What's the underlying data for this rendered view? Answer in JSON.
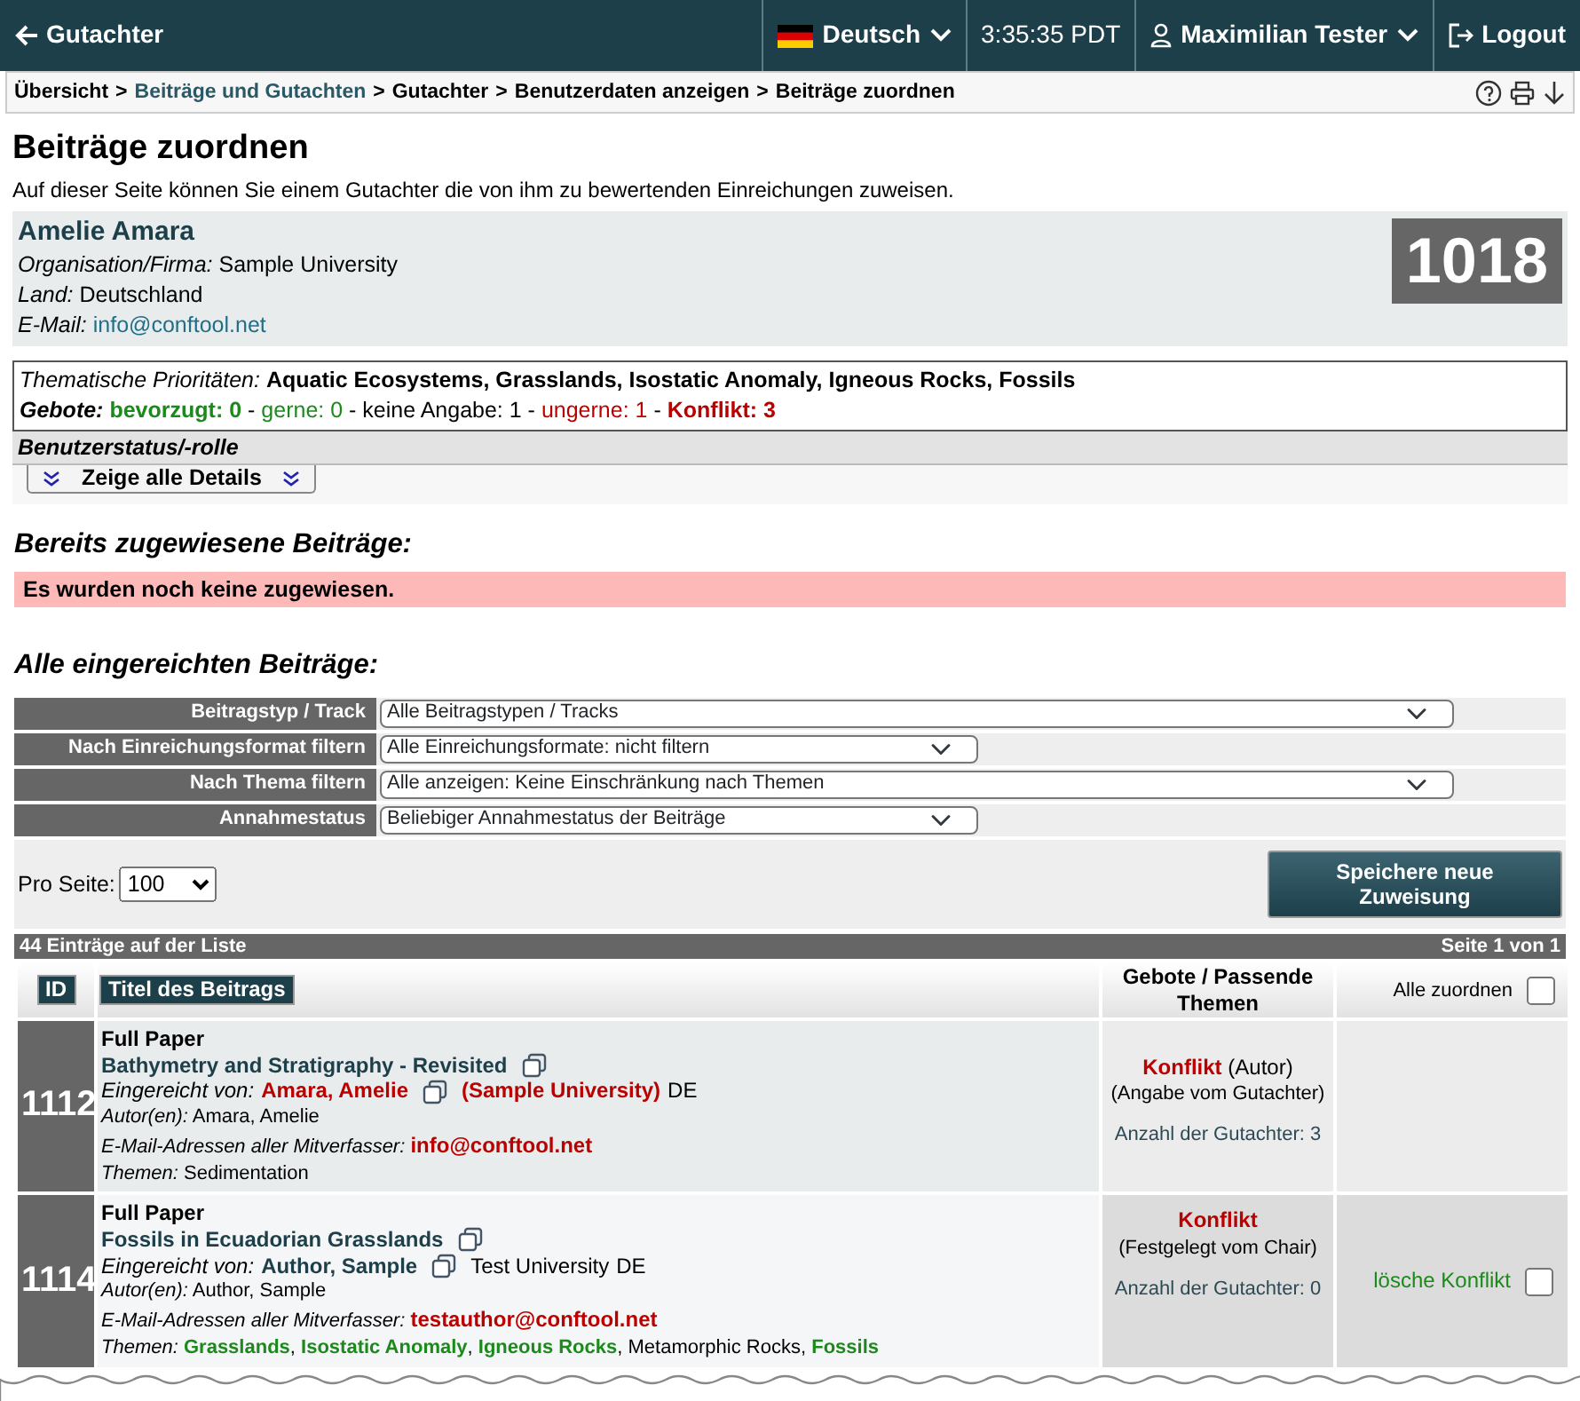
{
  "topbar": {
    "back": "Gutachter",
    "language": "Deutsch",
    "time": "3:35:35 PDT",
    "user": "Maximilian Tester",
    "logout": "Logout"
  },
  "breadcrumb": [
    {
      "label": "Übersicht",
      "link": false,
      "sep": ">"
    },
    {
      "label": "Beiträge und Gutachten",
      "link": true,
      "sep": ">"
    },
    {
      "label": "Gutachter",
      "link": false,
      "sep": ">"
    },
    {
      "label": "Benutzerdaten anzeigen",
      "link": false,
      "sep": ">"
    },
    {
      "label": "Beiträge zuordnen",
      "link": false
    }
  ],
  "title": "Beiträge zuordnen",
  "intro": "Auf dieser Seite können Sie einem Gutachter die von ihm zu bewertenden Einreichungen zuweisen.",
  "reviewer": {
    "name": "Amelie Amara",
    "id": "1018",
    "fields": [
      {
        "label": "Organisation/Firma:",
        "value": "Sample University",
        "link": false
      },
      {
        "label": "Land:",
        "value": "Deutschland",
        "link": false
      },
      {
        "label": "E-Mail:",
        "value": "info@conftool.net",
        "link": true
      }
    ]
  },
  "priorities": {
    "label": "Thematische Prioritäten:",
    "value": "Aquatic Ecosystems, Grasslands, Isostatic Anomaly, Igneous Rocks, Fossils"
  },
  "bids": [
    {
      "text": "Gebote:",
      "kind": "label"
    },
    {
      "text": "bevorzugt: 0",
      "kind": "strong-good"
    },
    {
      "text": "-",
      "kind": "plain"
    },
    {
      "text": "gerne: 0",
      "kind": "good"
    },
    {
      "text": "- keine Angabe: 1 -",
      "kind": "plain"
    },
    {
      "text": "ungerne: 1",
      "kind": "bad"
    },
    {
      "text": "-",
      "kind": "plain"
    },
    {
      "text": "Konflikt: 3",
      "kind": "strong-bad"
    }
  ],
  "status_heading": "Benutzerstatus/-rolle",
  "details_button": "Zeige alle Details",
  "assigned": {
    "heading": "Bereits zugewiesene Beiträge:",
    "message": "Es wurden noch keine zugewiesen."
  },
  "submissions": {
    "heading": "Alle eingereichten Beiträge:",
    "filters": [
      {
        "label": "Beitragstyp / Track",
        "value": "Alle Beitragstypen / Tracks"
      },
      {
        "label": "Nach Einreichungsformat filtern",
        "value": "Alle Einreichungsformate: nicht filtern"
      },
      {
        "label": "Nach Thema filtern",
        "value": "Alle anzeigen: Keine Einschränkung nach Themen"
      },
      {
        "label": "Annahmestatus",
        "value": "Beliebiger Annahmestatus der Beiträge"
      }
    ],
    "per_page_label": "Pro Seite:",
    "per_page": "100",
    "save_button": "Speichere neue Zuweisung"
  },
  "list": {
    "count": "44 Einträge auf der Liste",
    "page": "Seite 1 von 1",
    "columns": [
      "ID",
      "Titel des Beitrags",
      "Gebote / Passende Themen"
    ],
    "assign_all": "Alle zuordnen",
    "assign_all_checked": false,
    "rows": [
      {
        "id": "1112",
        "type": "Full Paper",
        "title": "Bathymetry and Stratigraphy - Revisited",
        "submitter_label": "Eingereicht von:",
        "submitter": "Amara, Amelie",
        "submitter_highlight": true,
        "org": "(Sample University)",
        "org_highlight": true,
        "country": "DE",
        "authors_label": "Autor(en):",
        "authors": "Amara, Amelie",
        "emails_label": "E-Mail-Adressen aller Mitverfasser:",
        "emails": "info@conftool.net",
        "topics_label": "Themen:",
        "topics": [
          {
            "name": "Sedimentation",
            "matched": false
          }
        ],
        "bid": {
          "status": "Konflikt",
          "detail": "(Autor)",
          "source": "(Angabe vom Gutachter)",
          "reviewers": "Anzahl der Gutachter: 3"
        }
      },
      {
        "id": "1114",
        "type": "Full Paper",
        "title": "Fossils in Ecuadorian Grasslands",
        "submitter_label": "Eingereicht von:",
        "submitter": "Author, Sample",
        "submitter_highlight": false,
        "org": "Test University",
        "org_highlight": false,
        "country": "DE",
        "authors_label": "Autor(en):",
        "authors": "Author, Sample",
        "emails_label": "E-Mail-Adressen aller Mitverfasser:",
        "emails": "testauthor@conftool.net",
        "topics_label": "Themen:",
        "topics": [
          {
            "name": "Grasslands",
            "matched": true,
            "sep": ","
          },
          {
            "name": "Isostatic Anomaly",
            "matched": true,
            "sep": ","
          },
          {
            "name": "Igneous Rocks",
            "matched": true,
            "sep": ","
          },
          {
            "name": "Metamorphic Rocks",
            "matched": false,
            "sep": ","
          },
          {
            "name": "Fossils",
            "matched": true
          }
        ],
        "bid": {
          "status": "Konflikt",
          "source": "(Festgelegt vom Chair)",
          "reviewers": "Anzahl der Gutachter: 0"
        },
        "action": "lösche Konflikt",
        "checked": false
      }
    ]
  }
}
